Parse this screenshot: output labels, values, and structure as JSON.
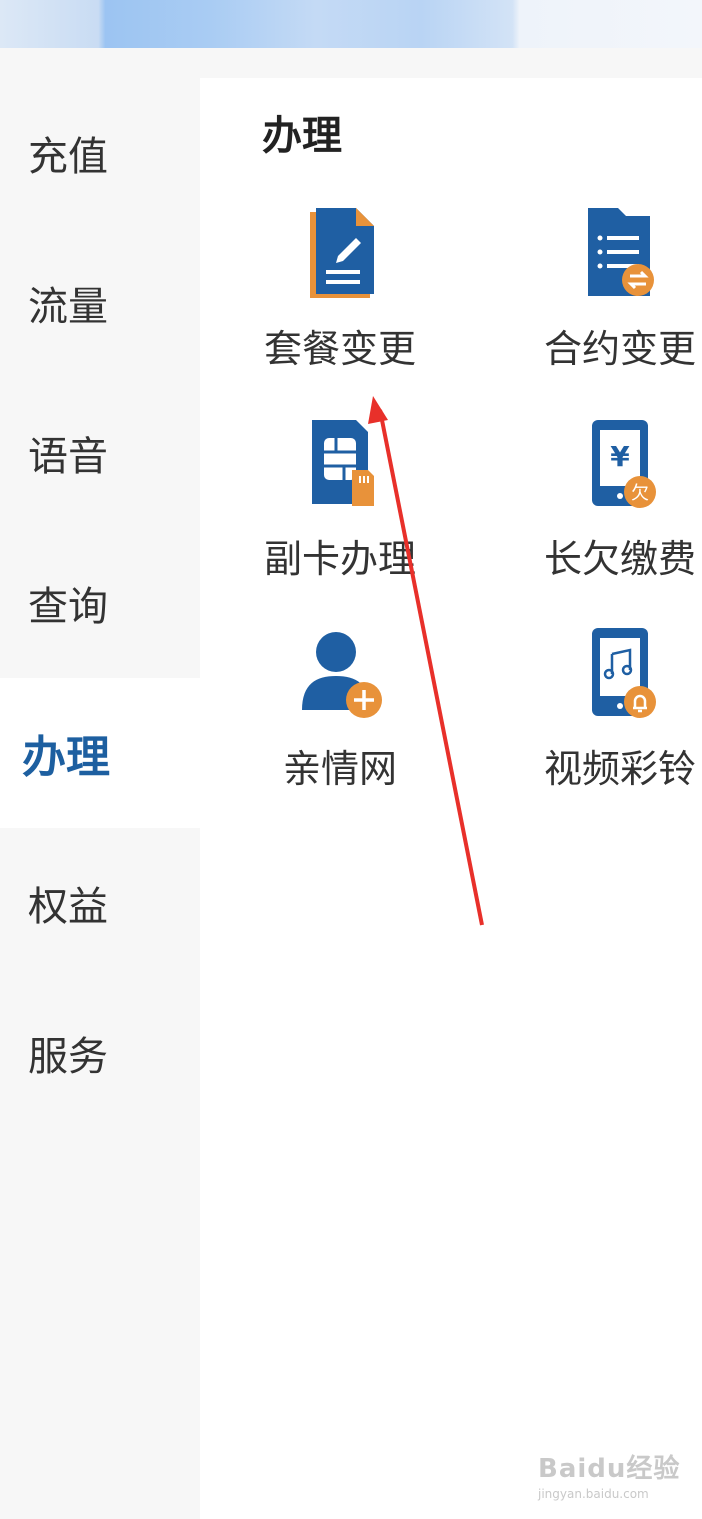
{
  "sidebar": {
    "items": [
      {
        "label": "充值"
      },
      {
        "label": "流量"
      },
      {
        "label": "语音"
      },
      {
        "label": "查询"
      },
      {
        "label": "办理",
        "active": true
      },
      {
        "label": "权益"
      },
      {
        "label": "服务"
      }
    ]
  },
  "main": {
    "title": "办理",
    "tiles": [
      {
        "label": "套餐变更",
        "icon": "plan-change-icon"
      },
      {
        "label": "合约变更",
        "icon": "contract-change-icon"
      },
      {
        "label": "副卡办理",
        "icon": "sim-card-icon"
      },
      {
        "label": "长欠缴费",
        "icon": "arrears-payment-icon"
      },
      {
        "label": "亲情网",
        "icon": "family-network-icon"
      },
      {
        "label": "视频彩铃",
        "icon": "video-ringtone-icon"
      }
    ]
  },
  "icon_glyphs": {
    "yen": "¥",
    "owe": "欠"
  },
  "watermark": {
    "main": "Baidu经验",
    "sub": "jingyan.baidu.com"
  },
  "colors": {
    "accent_blue": "#1d5fa0",
    "icon_blue": "#1f5fa3",
    "icon_orange": "#e8923a",
    "arrow_red": "#e8302a"
  }
}
